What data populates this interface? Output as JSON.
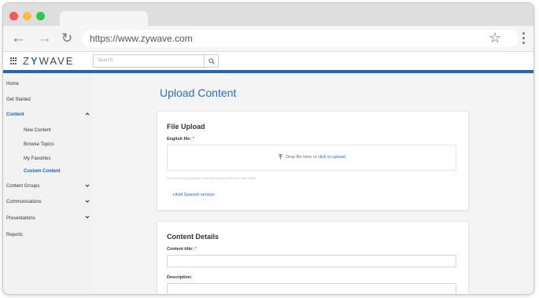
{
  "browser": {
    "url": "https://www.zywave.com",
    "icons": [
      "back-arrow-icon",
      "forward-arrow-icon",
      "reload-icon",
      "star-icon",
      "more-icon"
    ]
  },
  "app": {
    "logo": "ZYWAVE",
    "search_placeholder": "Search",
    "brand_color": "#1f64c8"
  },
  "sidebar": {
    "items": [
      {
        "label": "Home"
      },
      {
        "label": "Get Started"
      },
      {
        "label": "Content"
      },
      {
        "label": "New Content"
      },
      {
        "label": "Browse Topics"
      },
      {
        "label": "My Favorites"
      },
      {
        "label": "Custom Content"
      },
      {
        "label": "Content Groups"
      },
      {
        "label": "Communications"
      },
      {
        "label": "Presentations"
      },
      {
        "label": "Reports"
      }
    ]
  },
  "main": {
    "title": "Upload Content",
    "upload": {
      "title": "File Upload",
      "english_label": "English file:",
      "required_mark": "*",
      "drop_text": "Drop file here or",
      "click_text": "click to upload",
      "hint": "File cannot be password protected and must be less than 10MB.",
      "add_spanish": "+Add Spanish version"
    },
    "details": {
      "title": "Content Details",
      "content_title_label": "Content title:",
      "required_mark": "*",
      "description_label": "Description:",
      "content_title_value": "",
      "description_value": ""
    }
  }
}
